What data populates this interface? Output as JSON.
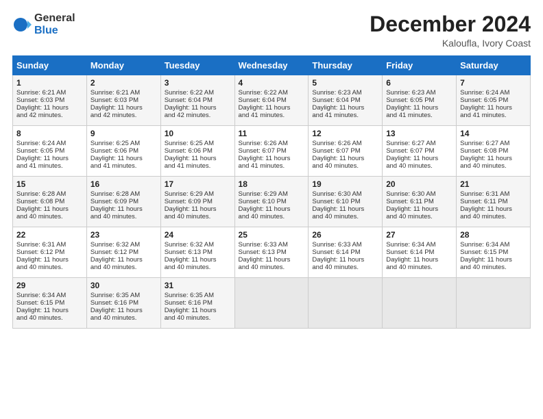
{
  "logo": {
    "general": "General",
    "blue": "Blue"
  },
  "title": "December 2024",
  "subtitle": "Kaloufla, Ivory Coast",
  "header_days": [
    "Sunday",
    "Monday",
    "Tuesday",
    "Wednesday",
    "Thursday",
    "Friday",
    "Saturday"
  ],
  "weeks": [
    [
      {
        "day": "1",
        "lines": [
          "Sunrise: 6:21 AM",
          "Sunset: 6:03 PM",
          "Daylight: 11 hours",
          "and 42 minutes."
        ]
      },
      {
        "day": "2",
        "lines": [
          "Sunrise: 6:21 AM",
          "Sunset: 6:03 PM",
          "Daylight: 11 hours",
          "and 42 minutes."
        ]
      },
      {
        "day": "3",
        "lines": [
          "Sunrise: 6:22 AM",
          "Sunset: 6:04 PM",
          "Daylight: 11 hours",
          "and 42 minutes."
        ]
      },
      {
        "day": "4",
        "lines": [
          "Sunrise: 6:22 AM",
          "Sunset: 6:04 PM",
          "Daylight: 11 hours",
          "and 41 minutes."
        ]
      },
      {
        "day": "5",
        "lines": [
          "Sunrise: 6:23 AM",
          "Sunset: 6:04 PM",
          "Daylight: 11 hours",
          "and 41 minutes."
        ]
      },
      {
        "day": "6",
        "lines": [
          "Sunrise: 6:23 AM",
          "Sunset: 6:05 PM",
          "Daylight: 11 hours",
          "and 41 minutes."
        ]
      },
      {
        "day": "7",
        "lines": [
          "Sunrise: 6:24 AM",
          "Sunset: 6:05 PM",
          "Daylight: 11 hours",
          "and 41 minutes."
        ]
      }
    ],
    [
      {
        "day": "8",
        "lines": [
          "Sunrise: 6:24 AM",
          "Sunset: 6:05 PM",
          "Daylight: 11 hours",
          "and 41 minutes."
        ]
      },
      {
        "day": "9",
        "lines": [
          "Sunrise: 6:25 AM",
          "Sunset: 6:06 PM",
          "Daylight: 11 hours",
          "and 41 minutes."
        ]
      },
      {
        "day": "10",
        "lines": [
          "Sunrise: 6:25 AM",
          "Sunset: 6:06 PM",
          "Daylight: 11 hours",
          "and 41 minutes."
        ]
      },
      {
        "day": "11",
        "lines": [
          "Sunrise: 6:26 AM",
          "Sunset: 6:07 PM",
          "Daylight: 11 hours",
          "and 41 minutes."
        ]
      },
      {
        "day": "12",
        "lines": [
          "Sunrise: 6:26 AM",
          "Sunset: 6:07 PM",
          "Daylight: 11 hours",
          "and 40 minutes."
        ]
      },
      {
        "day": "13",
        "lines": [
          "Sunrise: 6:27 AM",
          "Sunset: 6:07 PM",
          "Daylight: 11 hours",
          "and 40 minutes."
        ]
      },
      {
        "day": "14",
        "lines": [
          "Sunrise: 6:27 AM",
          "Sunset: 6:08 PM",
          "Daylight: 11 hours",
          "and 40 minutes."
        ]
      }
    ],
    [
      {
        "day": "15",
        "lines": [
          "Sunrise: 6:28 AM",
          "Sunset: 6:08 PM",
          "Daylight: 11 hours",
          "and 40 minutes."
        ]
      },
      {
        "day": "16",
        "lines": [
          "Sunrise: 6:28 AM",
          "Sunset: 6:09 PM",
          "Daylight: 11 hours",
          "and 40 minutes."
        ]
      },
      {
        "day": "17",
        "lines": [
          "Sunrise: 6:29 AM",
          "Sunset: 6:09 PM",
          "Daylight: 11 hours",
          "and 40 minutes."
        ]
      },
      {
        "day": "18",
        "lines": [
          "Sunrise: 6:29 AM",
          "Sunset: 6:10 PM",
          "Daylight: 11 hours",
          "and 40 minutes."
        ]
      },
      {
        "day": "19",
        "lines": [
          "Sunrise: 6:30 AM",
          "Sunset: 6:10 PM",
          "Daylight: 11 hours",
          "and 40 minutes."
        ]
      },
      {
        "day": "20",
        "lines": [
          "Sunrise: 6:30 AM",
          "Sunset: 6:11 PM",
          "Daylight: 11 hours",
          "and 40 minutes."
        ]
      },
      {
        "day": "21",
        "lines": [
          "Sunrise: 6:31 AM",
          "Sunset: 6:11 PM",
          "Daylight: 11 hours",
          "and 40 minutes."
        ]
      }
    ],
    [
      {
        "day": "22",
        "lines": [
          "Sunrise: 6:31 AM",
          "Sunset: 6:12 PM",
          "Daylight: 11 hours",
          "and 40 minutes."
        ]
      },
      {
        "day": "23",
        "lines": [
          "Sunrise: 6:32 AM",
          "Sunset: 6:12 PM",
          "Daylight: 11 hours",
          "and 40 minutes."
        ]
      },
      {
        "day": "24",
        "lines": [
          "Sunrise: 6:32 AM",
          "Sunset: 6:13 PM",
          "Daylight: 11 hours",
          "and 40 minutes."
        ]
      },
      {
        "day": "25",
        "lines": [
          "Sunrise: 6:33 AM",
          "Sunset: 6:13 PM",
          "Daylight: 11 hours",
          "and 40 minutes."
        ]
      },
      {
        "day": "26",
        "lines": [
          "Sunrise: 6:33 AM",
          "Sunset: 6:14 PM",
          "Daylight: 11 hours",
          "and 40 minutes."
        ]
      },
      {
        "day": "27",
        "lines": [
          "Sunrise: 6:34 AM",
          "Sunset: 6:14 PM",
          "Daylight: 11 hours",
          "and 40 minutes."
        ]
      },
      {
        "day": "28",
        "lines": [
          "Sunrise: 6:34 AM",
          "Sunset: 6:15 PM",
          "Daylight: 11 hours",
          "and 40 minutes."
        ]
      }
    ],
    [
      {
        "day": "29",
        "lines": [
          "Sunrise: 6:34 AM",
          "Sunset: 6:15 PM",
          "Daylight: 11 hours",
          "and 40 minutes."
        ]
      },
      {
        "day": "30",
        "lines": [
          "Sunrise: 6:35 AM",
          "Sunset: 6:16 PM",
          "Daylight: 11 hours",
          "and 40 minutes."
        ]
      },
      {
        "day": "31",
        "lines": [
          "Sunrise: 6:35 AM",
          "Sunset: 6:16 PM",
          "Daylight: 11 hours",
          "and 40 minutes."
        ]
      },
      null,
      null,
      null,
      null
    ]
  ]
}
